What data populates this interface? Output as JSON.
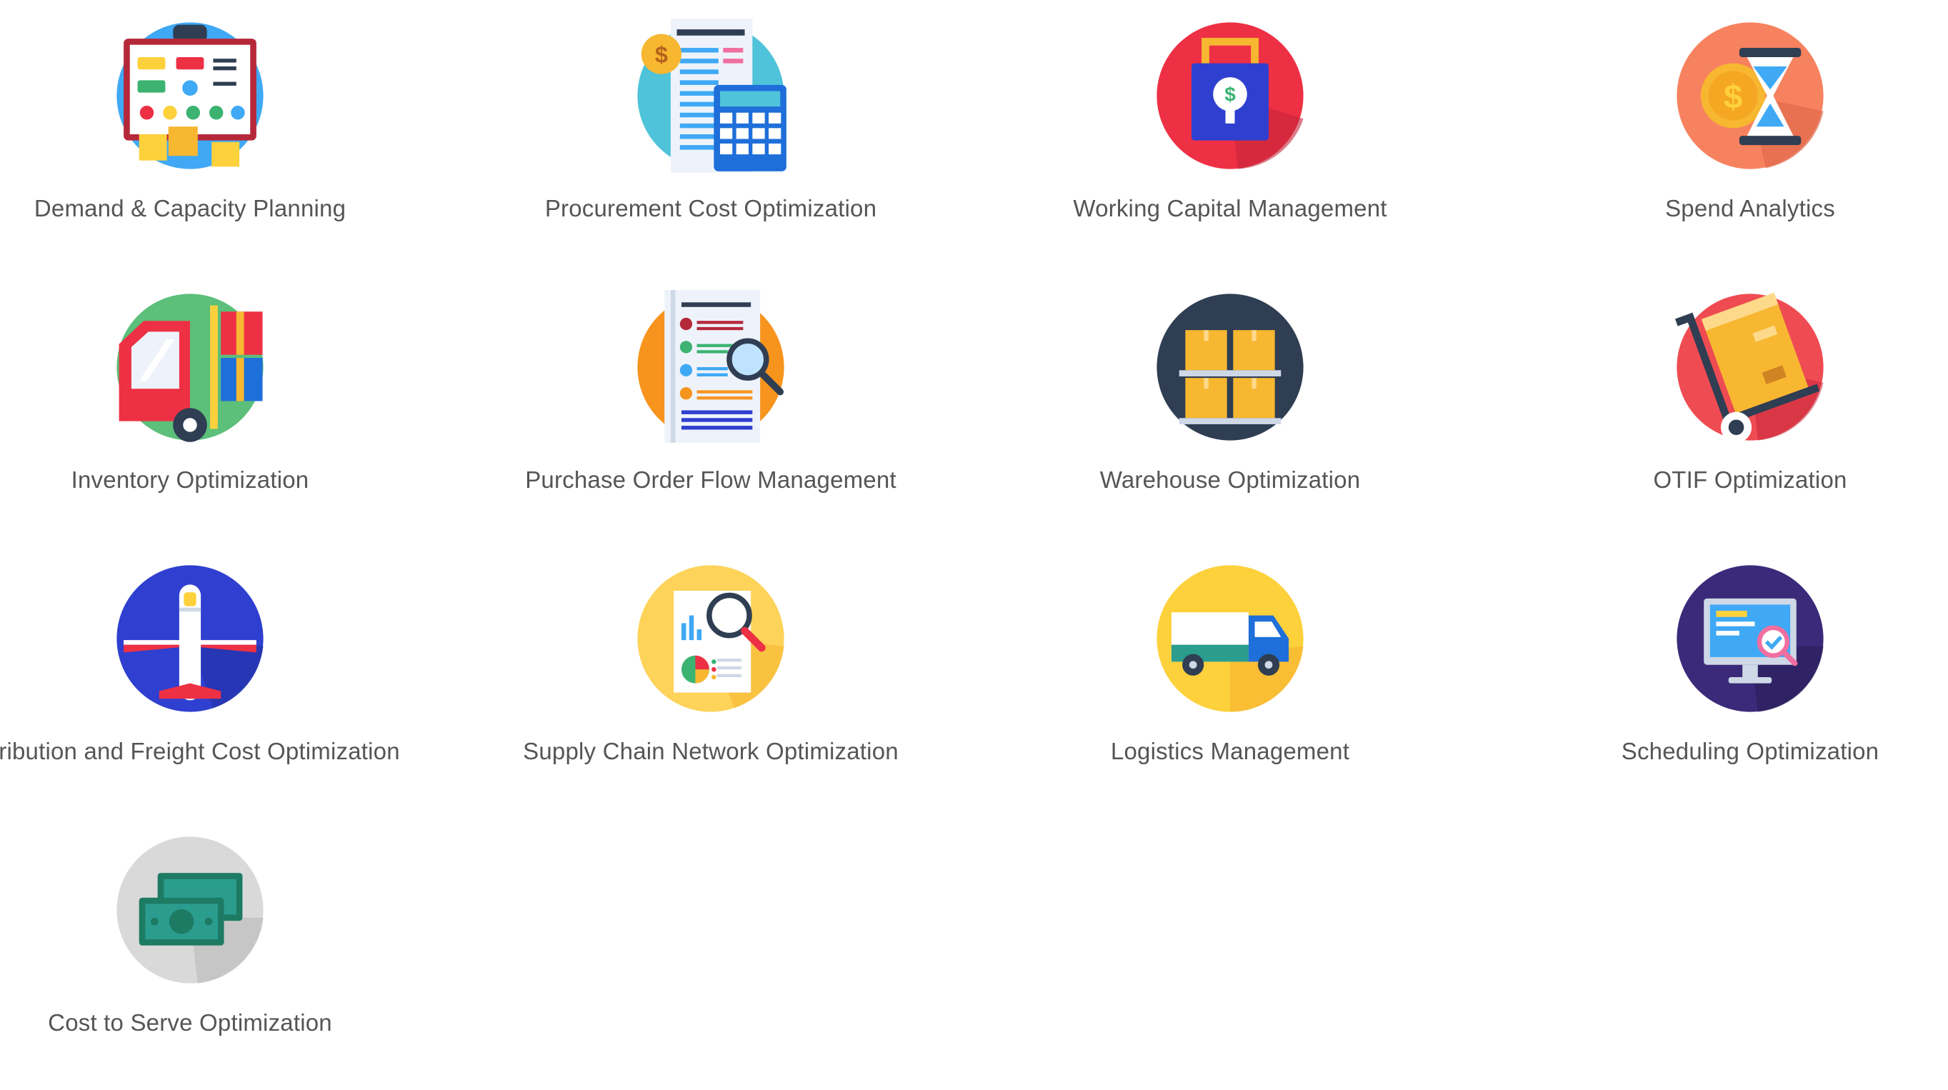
{
  "tiles": [
    {
      "label": "Demand & Capacity Planning",
      "icon": "planning-board-icon",
      "color": "#3fa9f5"
    },
    {
      "label": "Procurement Cost Optimization",
      "icon": "invoice-calculator-icon",
      "color": "#4fc3d9"
    },
    {
      "label": "Working Capital Management",
      "icon": "money-bag-icon",
      "color": "#ee3045"
    },
    {
      "label": "Spend Analytics",
      "icon": "hourglass-coin-icon",
      "color": "#f7825f"
    },
    {
      "label": "Inventory Optimization",
      "icon": "forklift-icon",
      "color": "#5cbf7a"
    },
    {
      "label": "Purchase Order Flow Management",
      "icon": "checklist-magnifier-icon",
      "color": "#f7941d"
    },
    {
      "label": "Warehouse Optimization",
      "icon": "pallet-boxes-icon",
      "color": "#2f3e52"
    },
    {
      "label": "OTIF Optimization",
      "icon": "hand-truck-icon",
      "color": "#ef4b52"
    },
    {
      "label": "stribution and Freight Cost Optimization",
      "icon": "airplane-icon",
      "color": "#2f3fcf"
    },
    {
      "label": "Supply Chain Network Optimization",
      "icon": "report-magnifier-icon",
      "color": "#fdd35a"
    },
    {
      "label": "Logistics Management",
      "icon": "delivery-truck-icon",
      "color": "#fdd13c"
    },
    {
      "label": "Scheduling Optimization",
      "icon": "monitor-check-icon",
      "color": "#3b2a7a"
    },
    {
      "label": "Cost to Serve Optimization",
      "icon": "banknotes-icon",
      "color": "#d9d9d9"
    }
  ]
}
